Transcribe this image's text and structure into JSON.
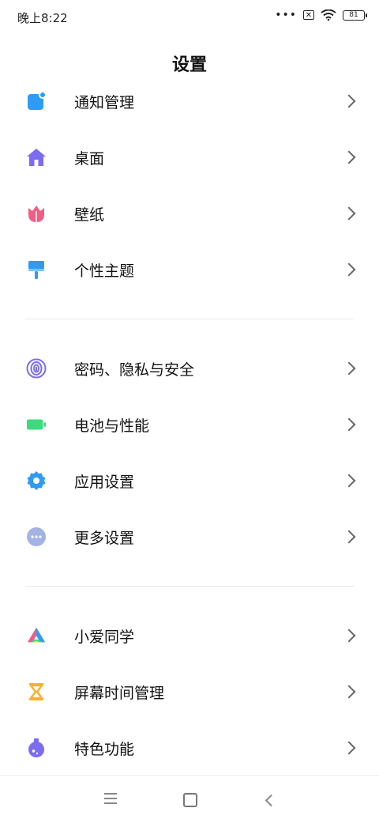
{
  "status_bar": {
    "time": "晚上8:22",
    "dots": "•••",
    "sim": "✕",
    "battery": "81"
  },
  "header": {
    "title": "设置"
  },
  "groups": [
    {
      "items": [
        {
          "label": "通知管理",
          "icon": "notification-icon"
        },
        {
          "label": "桌面",
          "icon": "home-icon"
        },
        {
          "label": "壁纸",
          "icon": "tulip-icon"
        },
        {
          "label": "个性主题",
          "icon": "paintbrush-icon"
        }
      ]
    },
    {
      "items": [
        {
          "label": "密码、隐私与安全",
          "icon": "fingerprint-icon"
        },
        {
          "label": "电池与性能",
          "icon": "battery-icon"
        },
        {
          "label": "应用设置",
          "icon": "gear-icon"
        },
        {
          "label": "更多设置",
          "icon": "more-icon"
        }
      ]
    },
    {
      "items": [
        {
          "label": "小爱同学",
          "icon": "xiaoai-icon"
        },
        {
          "label": "屏幕时间管理",
          "icon": "hourglass-icon"
        },
        {
          "label": "特色功能",
          "icon": "flask-icon"
        }
      ]
    }
  ],
  "colors": {
    "blue": "#2F9BF5",
    "purple": "#7B6CF0",
    "pink": "#F25D86",
    "green": "#3DDB7E",
    "gray_blue": "#A3B3E6",
    "orange": "#FFB02E"
  }
}
